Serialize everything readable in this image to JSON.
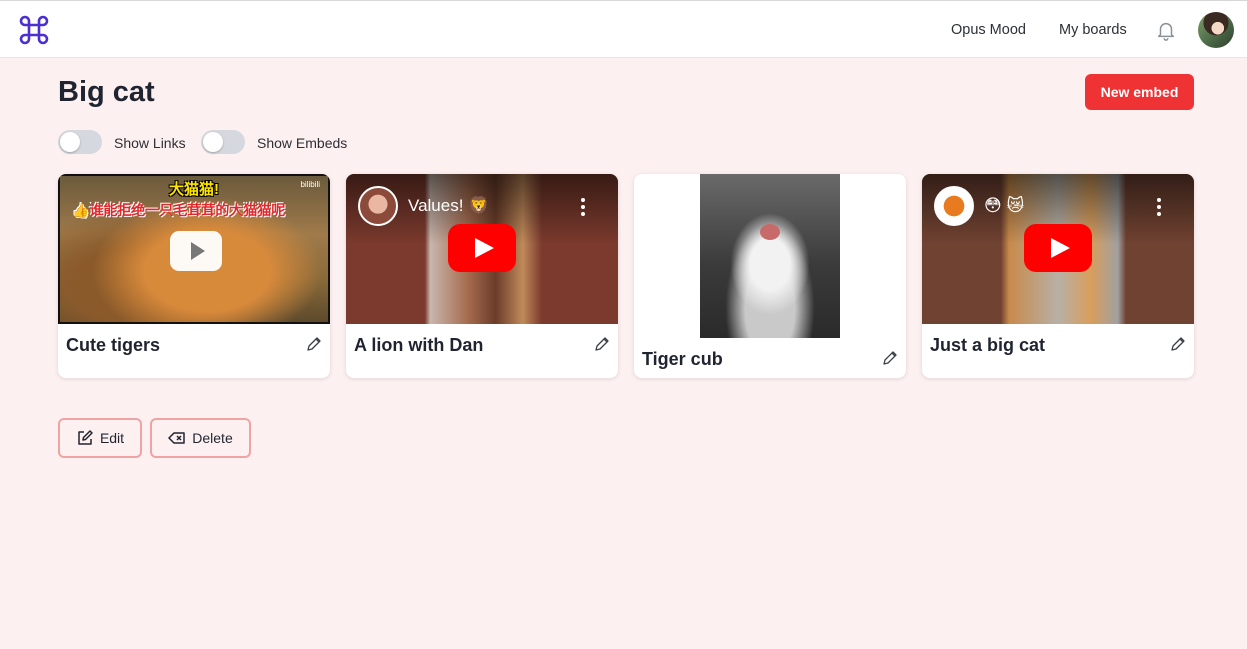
{
  "nav": {
    "logo_icon": "command-icon",
    "links": [
      "Opus Mood",
      "My boards"
    ],
    "notification_icon": "bell-icon",
    "avatar_icon": "user-avatar"
  },
  "board": {
    "title": "Big cat",
    "new_embed_label": "New embed"
  },
  "toggles": {
    "links_label": "Show Links",
    "links_on": false,
    "embeds_label": "Show Embeds",
    "embeds_on": false
  },
  "cards": [
    {
      "title": "Cute tigers",
      "source": "bilibili",
      "overlay_top": "大猫猫!",
      "overlay_sub": "👍谁能拒绝一只毛茸茸的大猫猫呢",
      "watermark": "bilibili"
    },
    {
      "title": "A lion with Dan",
      "source": "youtube",
      "video_title": "Values! 🦁"
    },
    {
      "title": "Tiger cub",
      "source": "image"
    },
    {
      "title": "Just a big cat",
      "source": "youtube",
      "video_title": "😳 😿"
    }
  ],
  "actions": {
    "edit_label": "Edit",
    "delete_label": "Delete"
  },
  "colors": {
    "background": "#fdf0f0",
    "accent_red": "#ef3234",
    "logo_purple": "#4b2fd1",
    "outline_pink": "#f0a3a3"
  }
}
